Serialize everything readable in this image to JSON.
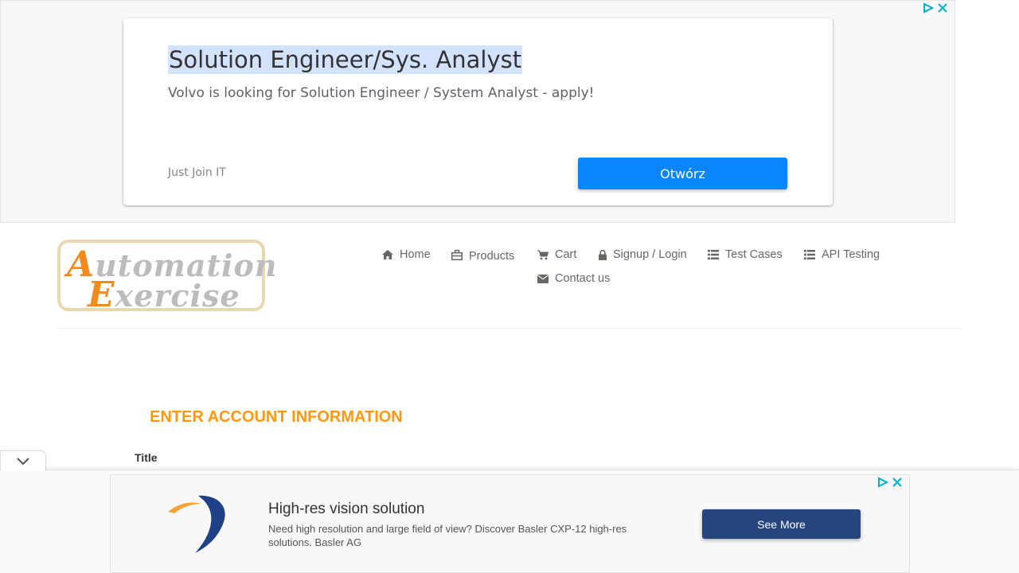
{
  "top_ad": {
    "title": "Solution Engineer/Sys. Analyst",
    "description": "Volvo is looking for Solution Engineer / System Analyst - apply!",
    "sponsor": "Just Join IT",
    "button_label": "Otwórz"
  },
  "logo": {
    "line1_initial": "A",
    "line1_rest": "utomation",
    "line2_initial": "E",
    "line2_rest": "xercise"
  },
  "nav": {
    "items": [
      {
        "label": "Home",
        "icon": "home-icon"
      },
      {
        "label": "Products",
        "icon": "briefcase-icon"
      },
      {
        "label": "Cart",
        "icon": "cart-icon"
      },
      {
        "label": "Signup / Login",
        "icon": "lock-icon"
      },
      {
        "label": "Test Cases",
        "icon": "list-icon"
      },
      {
        "label": "API Testing",
        "icon": "list-icon"
      },
      {
        "label": "Contact us",
        "icon": "envelope-icon"
      }
    ]
  },
  "form": {
    "section_title": "ENTER ACCOUNT INFORMATION",
    "title_label": "Title"
  },
  "bottom_ad": {
    "title": "High-res vision solution",
    "description": "Need high resolution and large field of view? Discover Basler CXP-12 high-res solutions. Basler AG",
    "button_label": "See More"
  },
  "colors": {
    "accent_orange": "#fe980f",
    "ad_button_blue": "#0a84ff",
    "bottom_ad_button": "#26447e",
    "adchoices_cyan": "#00aecd"
  }
}
